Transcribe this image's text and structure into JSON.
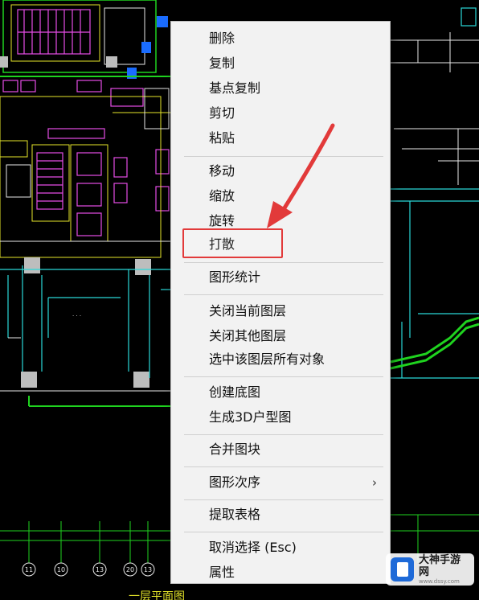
{
  "context_menu": {
    "items": [
      {
        "label": "删除"
      },
      {
        "label": "复制"
      },
      {
        "label": "基点复制"
      },
      {
        "label": "剪切"
      },
      {
        "label": "粘贴"
      },
      {
        "label": "移动"
      },
      {
        "label": "缩放"
      },
      {
        "label": "旋转"
      },
      {
        "label": "打散"
      },
      {
        "label": "图形统计"
      },
      {
        "label": "关闭当前图层"
      },
      {
        "label": "关闭其他图层"
      },
      {
        "label": "选中该图层所有对象"
      },
      {
        "label": "创建底图"
      },
      {
        "label": "生成3D户型图"
      },
      {
        "label": "合并图块"
      },
      {
        "label": "图形次序",
        "submenu_arrow": "›"
      },
      {
        "label": "提取表格"
      },
      {
        "label": "取消选择 (Esc)"
      },
      {
        "label": "属性"
      }
    ]
  },
  "highlight": {
    "target_item": "打散",
    "color": "#e23a3a"
  },
  "colors": {
    "cad_green": "#1fd31f",
    "cad_magenta": "#e64ce6",
    "cad_cyan": "#2ad8d8",
    "cad_yellow": "#e6e62a",
    "cad_white": "#e8e8e8",
    "cad_blue": "#1a6cff"
  },
  "cad_texts": {
    "axis_labels": [
      "11",
      "10",
      "13",
      "20",
      "13"
    ],
    "bottom_title": "一层平面图"
  },
  "watermark": {
    "title": "大神手游网",
    "url": "www.dssy.com",
    "icon": "box-logo-icon"
  }
}
